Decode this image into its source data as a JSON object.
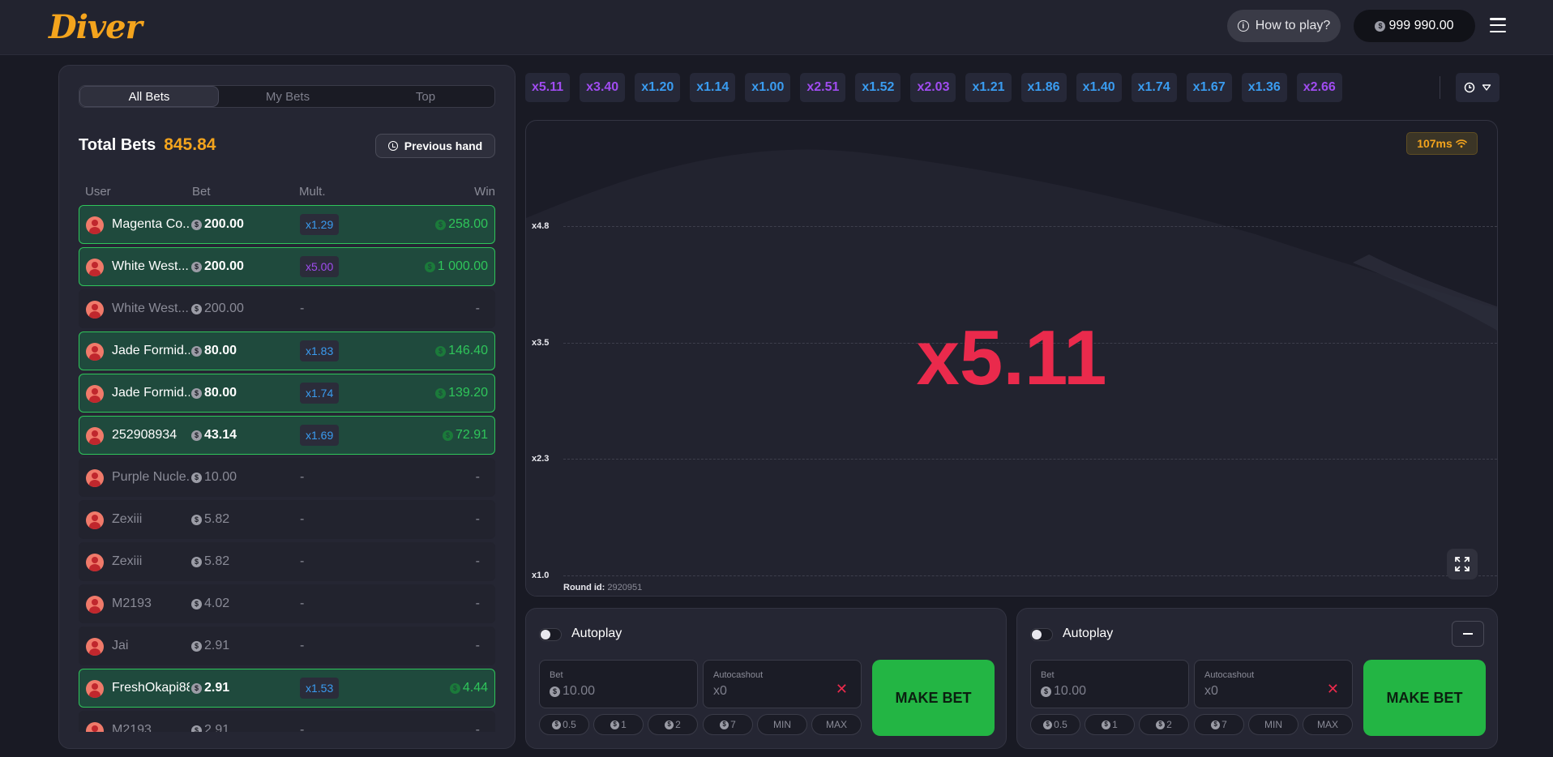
{
  "header": {
    "logo": "Diver",
    "how_to_play": "How to play?",
    "balance": "999 990.00"
  },
  "bets_panel": {
    "tabs": [
      "All Bets",
      "My Bets",
      "Top"
    ],
    "active_tab": "All Bets",
    "total_label": "Total Bets",
    "total_value": "845.84",
    "previous_hand": "Previous hand",
    "columns": [
      "User",
      "Bet",
      "Mult.",
      "Win"
    ],
    "rows": [
      {
        "user": "Magenta Co...",
        "bet": "200.00",
        "mult": "x1.29",
        "mult_color": "#3a9cf0",
        "win": "258.00",
        "won": true
      },
      {
        "user": "White West...",
        "bet": "200.00",
        "mult": "x5.00",
        "mult_color": "#a04cf0",
        "win": "1 000.00",
        "won": true
      },
      {
        "user": "White West...",
        "bet": "200.00",
        "mult": "-",
        "win": "-",
        "won": false
      },
      {
        "user": "Jade Formid...",
        "bet": "80.00",
        "mult": "x1.83",
        "mult_color": "#3a9cf0",
        "win": "146.40",
        "won": true
      },
      {
        "user": "Jade Formid...",
        "bet": "80.00",
        "mult": "x1.74",
        "mult_color": "#3a9cf0",
        "win": "139.20",
        "won": true
      },
      {
        "user": "252908934",
        "bet": "43.14",
        "mult": "x1.69",
        "mult_color": "#3a9cf0",
        "win": "72.91",
        "won": true
      },
      {
        "user": "Purple Nucle...",
        "bet": "10.00",
        "mult": "-",
        "win": "-",
        "won": false
      },
      {
        "user": "Zexiii",
        "bet": "5.82",
        "mult": "-",
        "win": "-",
        "won": false
      },
      {
        "user": "Zexiii",
        "bet": "5.82",
        "mult": "-",
        "win": "-",
        "won": false
      },
      {
        "user": "M2193",
        "bet": "4.02",
        "mult": "-",
        "win": "-",
        "won": false
      },
      {
        "user": "Jai",
        "bet": "2.91",
        "mult": "-",
        "win": "-",
        "won": false
      },
      {
        "user": "FreshOkapi88",
        "bet": "2.91",
        "mult": "x1.53",
        "mult_color": "#3a9cf0",
        "win": "4.44",
        "won": true
      },
      {
        "user": "M2193",
        "bet": "2.91",
        "mult": "-",
        "win": "-",
        "won": false
      }
    ]
  },
  "history": [
    {
      "v": "x5.11",
      "c": "#a04cf0"
    },
    {
      "v": "x3.40",
      "c": "#a04cf0"
    },
    {
      "v": "x1.20",
      "c": "#3a9cf0"
    },
    {
      "v": "x1.14",
      "c": "#3a9cf0"
    },
    {
      "v": "x1.00",
      "c": "#3a9cf0"
    },
    {
      "v": "x2.51",
      "c": "#a04cf0"
    },
    {
      "v": "x1.52",
      "c": "#3a9cf0"
    },
    {
      "v": "x2.03",
      "c": "#a04cf0"
    },
    {
      "v": "x1.21",
      "c": "#3a9cf0"
    },
    {
      "v": "x1.86",
      "c": "#3a9cf0"
    },
    {
      "v": "x1.40",
      "c": "#3a9cf0"
    },
    {
      "v": "x1.74",
      "c": "#3a9cf0"
    },
    {
      "v": "x1.67",
      "c": "#3a9cf0"
    },
    {
      "v": "x1.36",
      "c": "#3a9cf0"
    },
    {
      "v": "x2.66",
      "c": "#a04cf0"
    }
  ],
  "game": {
    "ping": "107ms",
    "multiplier": "x5.11",
    "y_labels": [
      "x4.8",
      "x3.5",
      "x2.3",
      "x1.0"
    ],
    "round_label": "Round id:",
    "round_id": "2920951"
  },
  "bet_panels": [
    {
      "autoplay": "Autoplay",
      "bet_label": "Bet",
      "bet_value": "10.00",
      "autocashout_label": "Autocashout",
      "autocashout_value": "x0",
      "quick": [
        "0.5",
        "1",
        "2",
        "7",
        "MIN",
        "MAX"
      ],
      "make_bet": "MAKE BET"
    },
    {
      "autoplay": "Autoplay",
      "bet_label": "Bet",
      "bet_value": "10.00",
      "autocashout_label": "Autocashout",
      "autocashout_value": "x0",
      "quick": [
        "0.5",
        "1",
        "2",
        "7",
        "MIN",
        "MAX"
      ],
      "make_bet": "MAKE BET"
    }
  ],
  "colors": {
    "accent": "#f4a41d",
    "win_green": "#2fc55a",
    "multiplier_red": "#ea2a4c",
    "blue": "#3a9cf0",
    "purple": "#a04cf0"
  }
}
